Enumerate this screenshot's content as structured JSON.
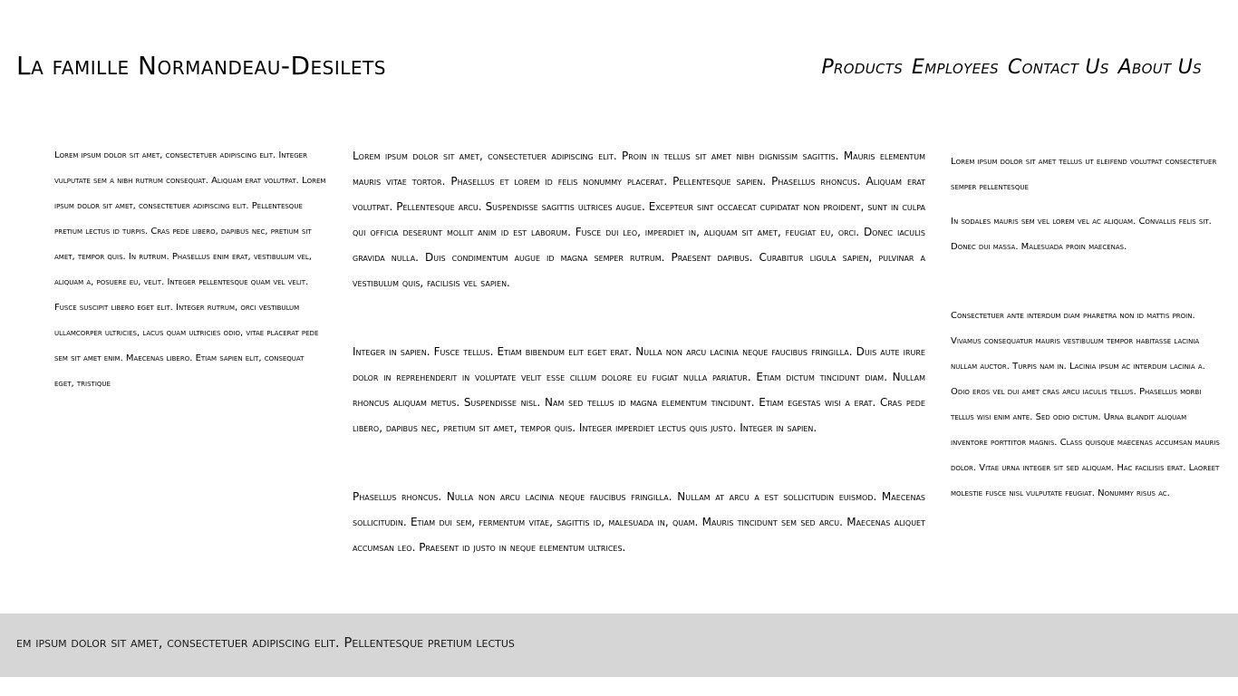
{
  "header": {
    "title": "La famille Normandeau-Desilets",
    "nav": [
      {
        "label": "Products"
      },
      {
        "label": "Employees"
      },
      {
        "label": "Contact Us"
      },
      {
        "label": "About Us"
      }
    ]
  },
  "left_column": {
    "text": "Lorem ipsum dolor sit amet, consectetuer adipiscing elit. Integer vulputate sem a nibh rutrum consequat. Aliquam erat volutpat. Lorem ipsum dolor sit amet, consectetuer adipiscing elit. Pellentesque pretium lectus id turpis. Cras pede libero, dapibus nec, pretium sit amet, tempor quis. In rutrum. Phasellus enim erat, vestibulum vel, aliquam a, posuere eu, velit. Integer pellentesque quam vel velit. Fusce suscipit libero eget elit. Integer rutrum, orci vestibulum ullamcorper ultricies, lacus quam ultricies odio, vitae placerat pede sem sit amet enim. Maecenas libero. Etiam sapien elit, consequat eget, tristique"
  },
  "main_column": {
    "paragraphs": [
      "Lorem ipsum dolor sit amet, consectetuer adipiscing elit. Proin in tellus sit amet nibh dignissim sagittis. Mauris elementum mauris vitae tortor. Phasellus et lorem id felis nonummy placerat. Pellentesque sapien. Phasellus rhoncus. Aliquam erat volutpat. Pellentesque arcu. Suspendisse sagittis ultrices augue. Excepteur sint occaecat cupidatat non proident, sunt in culpa qui officia deserunt mollit anim id est laborum. Fusce dui leo, imperdiet in, aliquam sit amet, feugiat eu, orci. Donec iaculis gravida nulla. Duis condimentum augue id magna semper rutrum. Praesent dapibus. Curabitur ligula sapien, pulvinar a vestibulum quis, facilisis vel sapien.",
      "Integer in sapien. Fusce tellus. Etiam bibendum elit eget erat. Nulla non arcu lacinia neque faucibus fringilla. Duis aute irure dolor in reprehenderit in voluptate velit esse cillum dolore eu fugiat nulla pariatur. Etiam dictum tincidunt diam. Nullam rhoncus aliquam metus. Suspendisse nisl. Nam sed tellus id magna elementum tincidunt. Etiam egestas wisi a erat. Cras pede libero, dapibus nec, pretium sit amet, tempor quis. Integer imperdiet lectus quis justo. Integer in sapien.",
      "Phasellus rhoncus. Nulla non arcu lacinia neque faucibus fringilla. Nullam at arcu a est sollicitudin euismod. Maecenas sollicitudin. Etiam dui sem, fermentum vitae, sagittis id, malesuada in, quam. Mauris tincidunt sem sed arcu. Maecenas aliquet accumsan leo. Praesent id justo in neque elementum ultrices."
    ]
  },
  "right_column": {
    "paragraphs": [
      "Lorem ipsum dolor sit amet tellus ut eleifend volutpat consectetuer semper pellentesque",
      "In sodales mauris sem vel lorem vel ac aliquam. Convallis felis sit. Donec dui massa. Malesuada proin maecenas.",
      "Consectetuer ante interdum diam pharetra non id mattis proin. Vivamus consequatur mauris vestibulum tempor habitasse lacinia nullam auctor. Turpis nam in. Lacinia ipsum ac interdum lacinia a. Odio eros vel dui amet cras arcu iaculis tellus. Phasellus morbi tellus wisi enim ante. Sed odio dictum. Urna blandit aliquam inventore porttitor magnis. Class quisque maecenas accumsan mauris dolor. Vitae urna integer sit sed aliquam. Hac facilisis erat. Laoreet molestie fusce nisl vulputate feugiat. Nonummy risus ac."
    ]
  },
  "footer": {
    "text": "em ipsum dolor sit amet, consectetuer adipiscing elit. Pellentesque pretium lectus"
  },
  "colors": {
    "background": "#ffffff",
    "text": "#000000",
    "footer_background": "#d6d6d6"
  }
}
